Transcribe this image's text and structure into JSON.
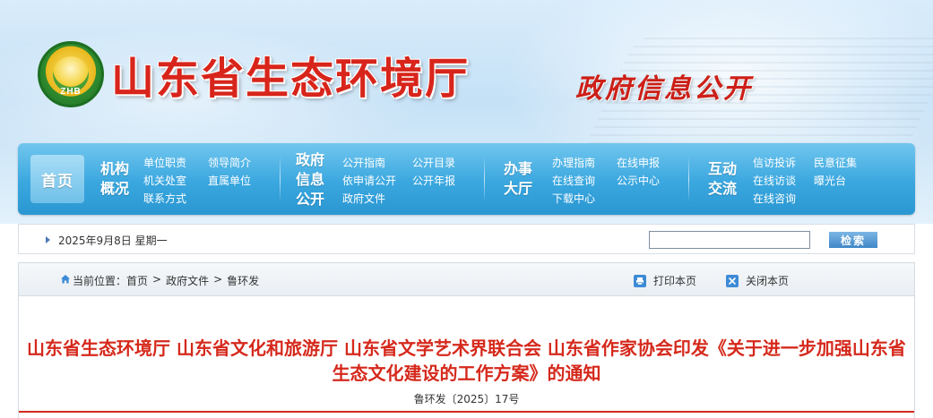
{
  "header": {
    "logo_text": "ZHB",
    "site_title": "山东省生态环境厅",
    "banner_slogan": "政府信息公开"
  },
  "nav": {
    "home": "首页",
    "groups": [
      {
        "title_lines": [
          "机构",
          "概况"
        ],
        "links": [
          "单位职责",
          "领导简介",
          "机关处室",
          "直属单位",
          "联系方式"
        ]
      },
      {
        "title_lines": [
          "政府",
          "信息",
          "公开"
        ],
        "links": [
          "公开指南",
          "公开目录",
          "依申请公开",
          "公开年报",
          "政府文件"
        ]
      },
      {
        "title_lines": [
          "办事",
          "大厅"
        ],
        "links": [
          "办理指南",
          "在线申报",
          "在线查询",
          "公示中心",
          "下载中心"
        ]
      },
      {
        "title_lines": [
          "互动",
          "交流"
        ],
        "links": [
          "信访投诉",
          "民意征集",
          "在线访谈",
          "曝光台",
          "在线咨询"
        ]
      }
    ]
  },
  "datebar": {
    "date": "2025年9月8日 星期一",
    "search_value": "",
    "search_button": "检索"
  },
  "breadcrumb": {
    "prefix": "当前位置：",
    "items": [
      "首页",
      "政府文件",
      "鲁环发"
    ],
    "separator": ">",
    "print_label": "打印本页",
    "close_label": "关闭本页"
  },
  "article": {
    "title": "山东省生态环境厅 山东省文化和旅游厅 山东省文学艺术界联合会 山东省作家协会印发《关于进一步加强山东省生态文化建设的工作方案》的通知",
    "doc_number": "鲁环发〔2025〕17号"
  },
  "colors": {
    "title_red": "#d8251b",
    "nav_blue": "#3aa7df",
    "article_title_red": "#d5291c"
  }
}
